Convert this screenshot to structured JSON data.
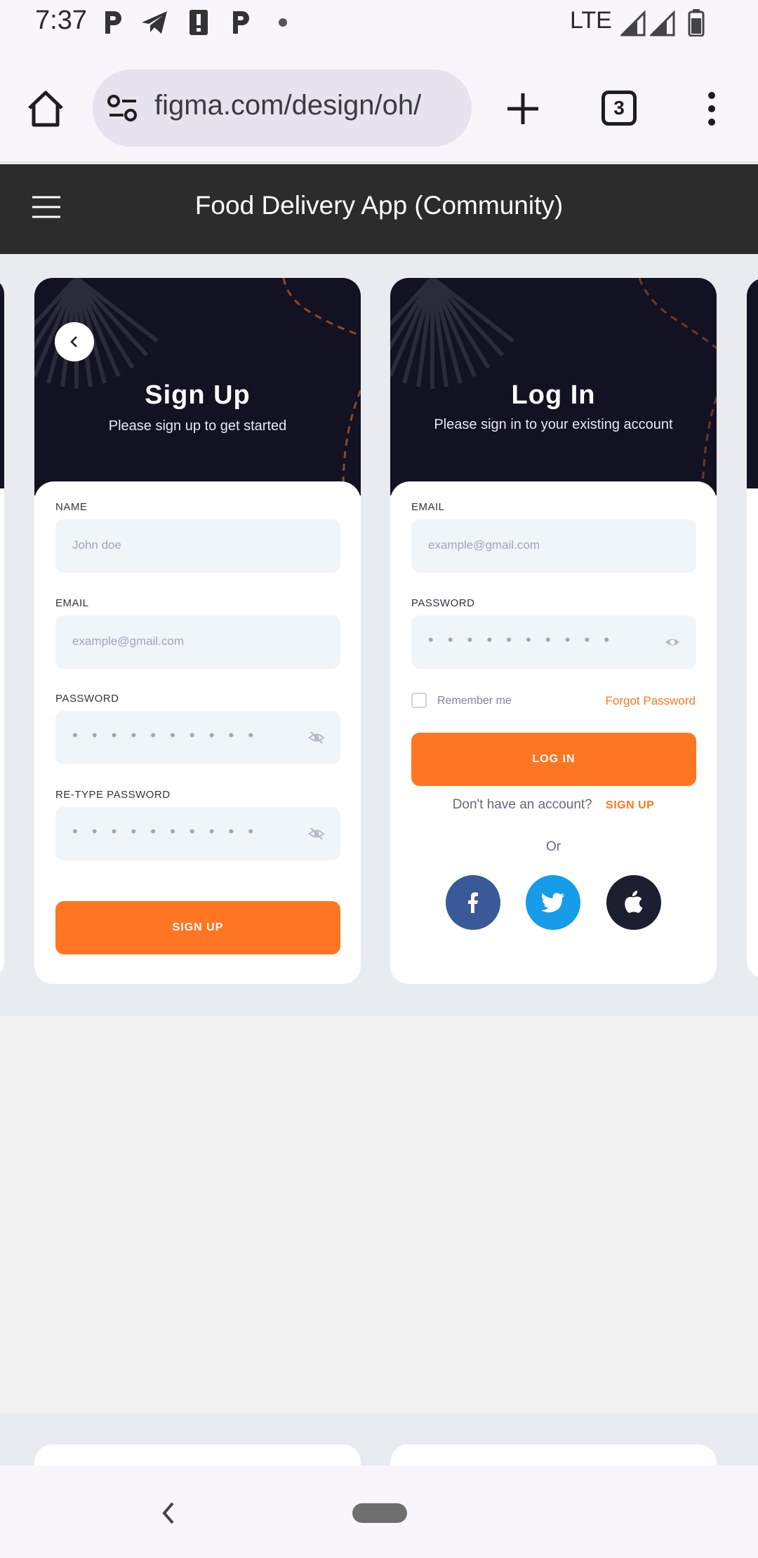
{
  "status_bar": {
    "time": "7:37",
    "network": "LTE",
    "icons": [
      "parking-icon",
      "telegram-icon",
      "alert-icon",
      "parking-icon",
      "dot-icon",
      "signal-icon",
      "signal-icon",
      "battery-icon"
    ]
  },
  "browser": {
    "url": "figma.com/design/oh/",
    "tab_count": "3",
    "icons": [
      "home-icon",
      "site-settings-icon",
      "new-tab-icon",
      "tabs-icon",
      "more-icon"
    ]
  },
  "figma": {
    "title": "Food Delivery App (Community)",
    "menu_icon": "hamburger-icon"
  },
  "signup": {
    "title": "Sign Up",
    "subtitle": "Please sign up to get started",
    "name_label": "NAME",
    "name_placeholder": "John doe",
    "email_label": "EMAIL",
    "email_placeholder": "example@gmail.com",
    "password_label": "PASSWORD",
    "password_value": "• • • • • • • • • •",
    "retype_label": "RE-TYPE PASSWORD",
    "retype_value": "• • • • • • • • • •",
    "button": "SIGN UP"
  },
  "login": {
    "title": "Log In",
    "subtitle": "Please sign in to your existing account",
    "email_label": "EMAIL",
    "email_placeholder": "example@gmail.com",
    "password_label": "PASSWORD",
    "password_value": "• • • • • • • • • •",
    "remember_me": "Remember me",
    "forgot": "Forgot Password",
    "button": "LOG IN",
    "no_account": "Don't have an account?",
    "signup_link": "SIGN UP",
    "or": "Or",
    "social": [
      "facebook-icon",
      "twitter-icon",
      "apple-icon"
    ]
  },
  "colors": {
    "accent": "#FF7622",
    "card_header": "#121223",
    "facebook": "#395998",
    "twitter": "#169CE8",
    "apple": "#1B1F2F"
  }
}
